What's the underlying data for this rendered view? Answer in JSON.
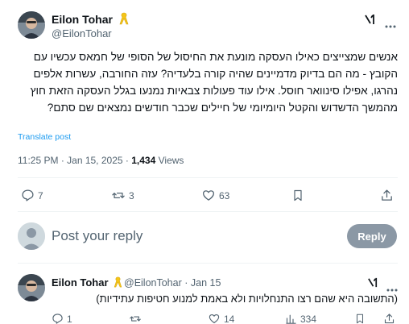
{
  "tweet": {
    "author_name": "Eilon Tohar",
    "author_handle": "@EilonTohar",
    "text": "אנשים שמצייצים כאילו העסקה מונעת את החיסול של הסופי של חמאס עכשיו עם הקובץ - מה הם בדיוק מדמיינים שהיה קורה בלעדיה? עזה החורבה, עשרות אלפים נהרגו, אפילו סינוואר חוסל. אילו עוד פעולות צבאיות נמנעו בגלל העסקה הזאת חוץ מהמשך הדשדוש והקטל היומיומי של חיילים שכבר חודשים נמצאים שם סתם?",
    "translate_label": "Translate post",
    "time": "11:25 PM",
    "date": "Jan 15, 2025",
    "views_count": "1,434",
    "views_label": "Views",
    "actions": {
      "replies": "7",
      "reposts": "3",
      "likes": "63"
    }
  },
  "composer": {
    "placeholder": "Post your reply",
    "reply_button": "Reply"
  },
  "reply": {
    "author_name": "Eilon Tohar",
    "author_handle": "@EilonTohar",
    "date": "Jan 15",
    "text": "(התשובה היא שהם רצו התנחלויות ולא באמת למנוע חטיפות עתידיות)",
    "actions": {
      "replies": "1",
      "reposts": "",
      "likes": "14",
      "views": "334"
    }
  },
  "icons": {
    "ribbon": "yellow-ribbon-icon",
    "grok": "grok-icon",
    "more": "more-icon",
    "reply": "reply-icon",
    "repost": "repost-icon",
    "like": "heart-icon",
    "bookmark": "bookmark-icon",
    "share": "share-icon",
    "views": "views-icon"
  },
  "colors": {
    "link": "#1d9bf0",
    "muted": "#536471",
    "ribbon": "#f5c518",
    "reply_button_bg": "#8b98a5"
  }
}
